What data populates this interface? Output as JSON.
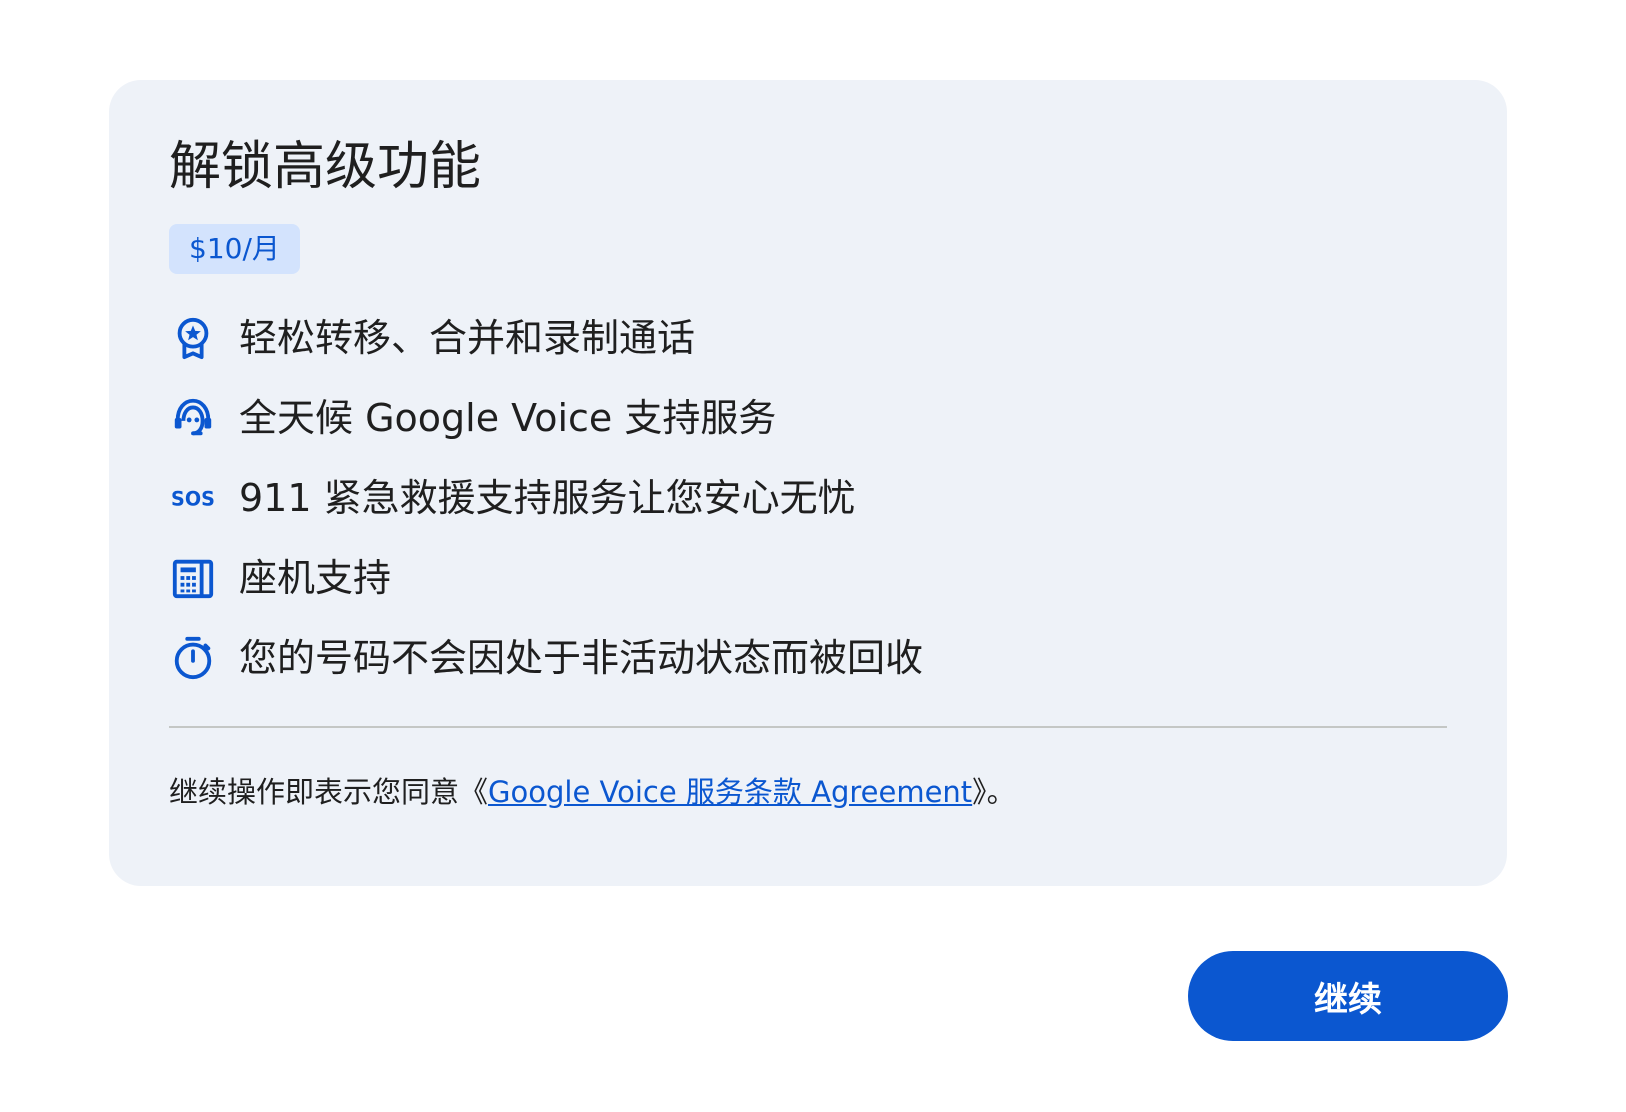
{
  "card": {
    "title": "解锁高级功能",
    "price": "$10/月",
    "features": [
      {
        "icon": "award-star-icon",
        "text": "轻松转移、合并和录制通话"
      },
      {
        "icon": "support-agent-icon",
        "text": "全天候 Google Voice 支持服务"
      },
      {
        "icon": "sos-icon",
        "text": "911 紧急救援支持服务让您安心无忧"
      },
      {
        "icon": "desk-phone-icon",
        "text": "座机支持"
      },
      {
        "icon": "timer-icon",
        "text": "您的号码不会因处于非活动状态而被回收"
      }
    ],
    "terms_prefix": "继续操作即表示您同意《",
    "terms_link": "Google Voice 服务条款 Agreement",
    "terms_suffix": "》。"
  },
  "continue_label": "继续",
  "colors": {
    "accent": "#0b57d0",
    "card_bg": "#eef2f8",
    "badge_bg": "#d3e3fd"
  }
}
